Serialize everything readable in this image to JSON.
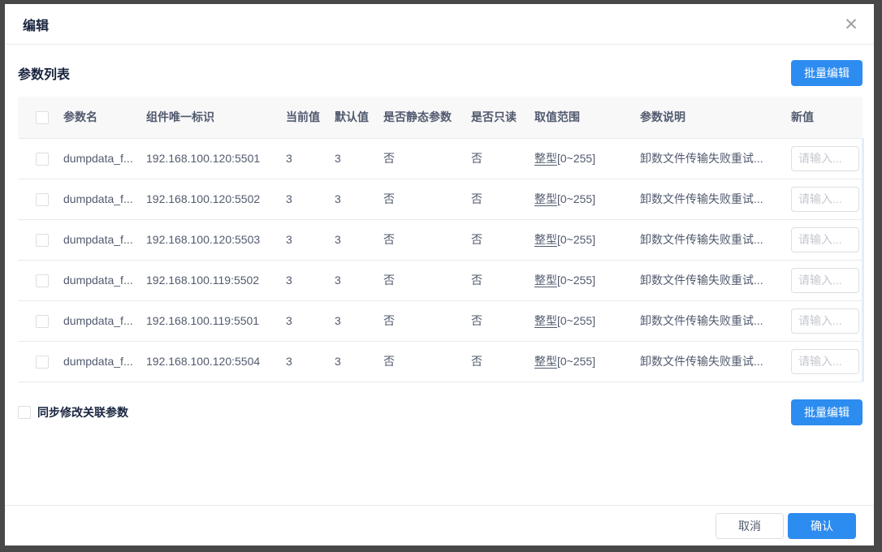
{
  "modal": {
    "title": "编辑",
    "close_icon": "✕"
  },
  "section": {
    "title": "参数列表",
    "batch_edit_label": "批量编辑"
  },
  "table": {
    "headers": [
      "参数名",
      "组件唯一标识",
      "当前值",
      "默认值",
      "是否静态参数",
      "是否只读",
      "取值范围",
      "参数说明",
      "新值"
    ],
    "rows": [
      {
        "name": "dumpdata_f...",
        "component_id": "192.168.100.120:5501",
        "current": "3",
        "default": "3",
        "is_static": "否",
        "is_readonly": "否",
        "range_term": "整型",
        "range_rest": "[0~255]",
        "description": "卸数文件传输失败重试...",
        "new_value_placeholder": "请输入..."
      },
      {
        "name": "dumpdata_f...",
        "component_id": "192.168.100.120:5502",
        "current": "3",
        "default": "3",
        "is_static": "否",
        "is_readonly": "否",
        "range_term": "整型",
        "range_rest": "[0~255]",
        "description": "卸数文件传输失败重试...",
        "new_value_placeholder": "请输入..."
      },
      {
        "name": "dumpdata_f...",
        "component_id": "192.168.100.120:5503",
        "current": "3",
        "default": "3",
        "is_static": "否",
        "is_readonly": "否",
        "range_term": "整型",
        "range_rest": "[0~255]",
        "description": "卸数文件传输失败重试...",
        "new_value_placeholder": "请输入..."
      },
      {
        "name": "dumpdata_f...",
        "component_id": "192.168.100.119:5502",
        "current": "3",
        "default": "3",
        "is_static": "否",
        "is_readonly": "否",
        "range_term": "整型",
        "range_rest": "[0~255]",
        "description": "卸数文件传输失败重试...",
        "new_value_placeholder": "请输入..."
      },
      {
        "name": "dumpdata_f...",
        "component_id": "192.168.100.119:5501",
        "current": "3",
        "default": "3",
        "is_static": "否",
        "is_readonly": "否",
        "range_term": "整型",
        "range_rest": "[0~255]",
        "description": "卸数文件传输失败重试...",
        "new_value_placeholder": "请输入..."
      },
      {
        "name": "dumpdata_f...",
        "component_id": "192.168.100.120:5504",
        "current": "3",
        "default": "3",
        "is_static": "否",
        "is_readonly": "否",
        "range_term": "整型",
        "range_rest": "[0~255]",
        "description": "卸数文件传输失败重试...",
        "new_value_placeholder": "请输入..."
      }
    ]
  },
  "sync": {
    "label": "同步修改关联参数",
    "batch_edit_label": "批量编辑"
  },
  "footer": {
    "cancel_label": "取消",
    "confirm_label": "确认"
  },
  "colors": {
    "primary": "#2d8cf0",
    "header_bg": "#f8f8f9",
    "border": "#e8eaec",
    "body_text": "#515a6e",
    "title_text": "#17233d"
  }
}
